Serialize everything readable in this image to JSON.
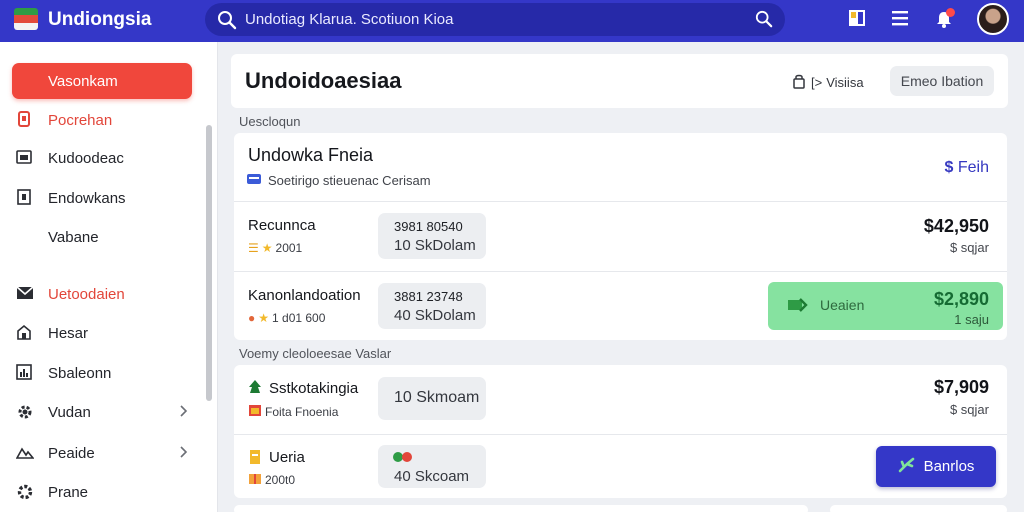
{
  "app": {
    "title": "Undiongsia",
    "search_text": "Undotiag Klarua. Scotiuon Kioa"
  },
  "colors": {
    "brand": "#3437c8",
    "accent_red": "#f0473c",
    "success_green": "#86e2a0"
  },
  "topbar_icons": [
    "grid-icon",
    "menu-icon",
    "bell-icon",
    "avatar"
  ],
  "sidebar": {
    "items": [
      {
        "label": "Vasonkam",
        "icon": "none",
        "active": true
      },
      {
        "label": "Pocrehan",
        "icon": "file-red-icon",
        "red": true
      },
      {
        "label": "Kudoodeac",
        "icon": "image-icon"
      },
      {
        "label": "Endowkans",
        "icon": "document-icon"
      },
      {
        "label": "Vabane",
        "icon": "none"
      },
      {
        "label": "Uetoodaien",
        "icon": "mail-icon",
        "red": true
      },
      {
        "label": "Hesar",
        "icon": "home-icon"
      },
      {
        "label": "Sbaleonn",
        "icon": "chart-icon"
      },
      {
        "label": "Vudan",
        "icon": "gear-icon",
        "chevron": true
      },
      {
        "label": "Peaide",
        "icon": "mountain-icon",
        "chevron": true
      },
      {
        "label": "Prane",
        "icon": "settings-icon"
      }
    ]
  },
  "header": {
    "title": "Undoidoaesiaa",
    "button1": "Visiisa",
    "button2": "Emeo Ibation"
  },
  "section1": {
    "label": "Uescloqun",
    "account_title": "Undowka Fneia",
    "account_sub": "Soetirigo stieuenac Cerisam",
    "account_link": "Feih",
    "rows": [
      {
        "name": "Recunnca",
        "meta": "2001",
        "pill_line1": "3981 80540",
        "pill_line2": "10 SkDolam",
        "amount": "$42,950",
        "amount_sub": "$ sqjar"
      },
      {
        "name": "Kanonlandoation",
        "meta": "1 d01 600",
        "pill_line1": "3881 23748",
        "pill_line2": "40 SkDolam",
        "status_label": "Ueaien",
        "amount": "$2,890",
        "amount_sub": "1 saju"
      }
    ]
  },
  "section2": {
    "label": "Voemy cleoloeesae Vaslar",
    "rows": [
      {
        "name": "Sstkotakingia",
        "meta": "Foita Fnoenia",
        "pill_line2": "10 Skmoam",
        "amount": "$7,909",
        "amount_sub": "$ sqjar"
      },
      {
        "name": "Ueria",
        "meta": "200t0",
        "pill_line2": "40 Skcoam",
        "button": "Banrlos"
      }
    ]
  }
}
